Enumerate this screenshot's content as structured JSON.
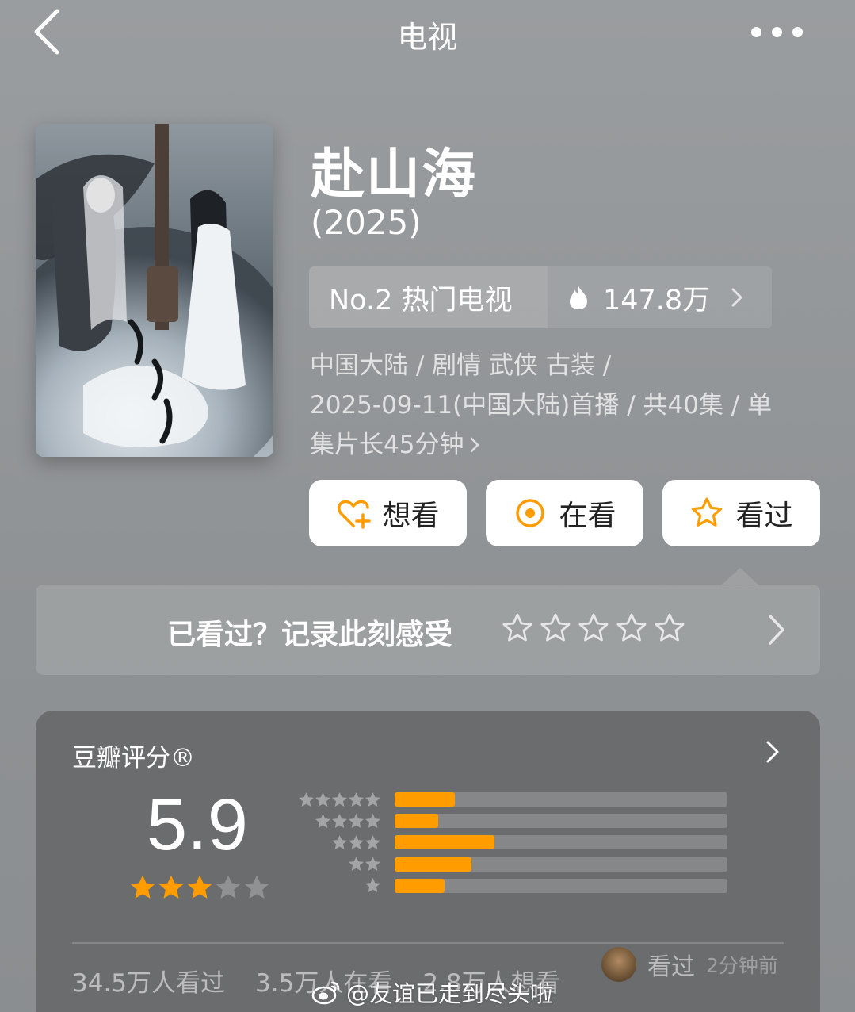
{
  "nav": {
    "title": "电视"
  },
  "movie": {
    "title": "赴山海",
    "year": "(2025)",
    "rank_label": "No.2 热门电视",
    "heat": "147.8万",
    "meta_line1": "中国大陆 / 剧情 武侠 古装 /",
    "meta_line2": "2025-09-11(中国大陆)首播 / 共40集 / 单",
    "meta_line3": "集片长45分钟"
  },
  "actions": {
    "want": "想看",
    "watching": "在看",
    "watched": "看过"
  },
  "rate_prompt": {
    "text": "已看过？记录此刻感受",
    "stars": 5
  },
  "rating": {
    "label": "豆瓣评分®",
    "score": "5.9",
    "stars_filled": 3,
    "stars_total": 5,
    "distribution": [
      {
        "stars": 5,
        "fraction": 0.18
      },
      {
        "stars": 4,
        "fraction": 0.13
      },
      {
        "stars": 3,
        "fraction": 0.3
      },
      {
        "stars": 2,
        "fraction": 0.23
      },
      {
        "stars": 1,
        "fraction": 0.15
      }
    ],
    "stat_watched": "34.5万人看过",
    "stat_watching": "3.5万人在看",
    "stat_want": "2.8万人想看",
    "friend_action": "看过",
    "friend_time": "2分钟前"
  },
  "watermark": "@友谊已走到尽头啦",
  "colors": {
    "accent": "#ff9c00",
    "background": "#999c9e",
    "card": "#6a6c6e"
  },
  "icons": [
    "back-icon",
    "more-icon",
    "fire-icon",
    "chevron-right-icon",
    "heart-plus-icon",
    "target-icon",
    "star-outline-icon",
    "weibo-icon"
  ]
}
